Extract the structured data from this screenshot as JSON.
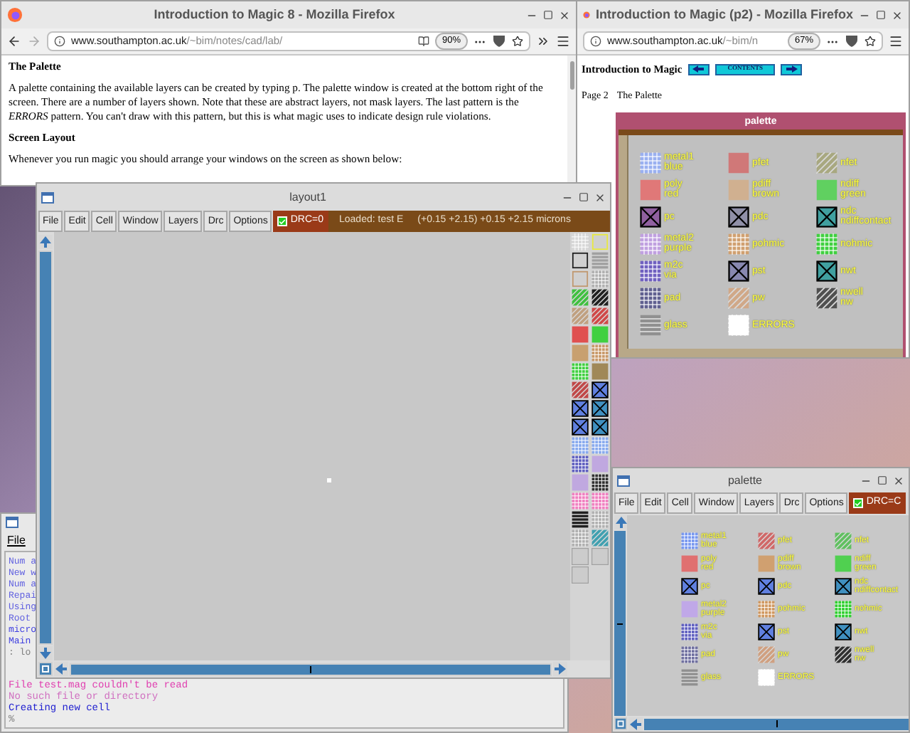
{
  "browser_main": {
    "title": "Introduction to Magic 8 - Mozilla Firefox",
    "url_host": "www.southampton.ac.uk",
    "url_path": "/~bim/notes/cad/lab/",
    "zoom": "90%",
    "heading_1": "The Palette",
    "paragraph_1": "A palette containing the available layers can be created by typing p. The palette window is created at the bottom right of the screen. There are a number of layers shown. Note that these are abstract layers, not mask layers. The last pattern is the *ERRORS* pattern. You can't draw with this pattern, but this is what magic uses to indicate design rule violations.",
    "heading_2": "Screen Layout",
    "paragraph_2": "Whenever you run magic you should arrange your windows on the screen as shown below:"
  },
  "browser_p2": {
    "title": "Introduction to Magic (p2) - Mozilla Firefox",
    "url_host": "www.southampton.ac.uk",
    "url_path": "/~bim/n",
    "zoom": "67%",
    "page_title": "Introduction to Magic",
    "contents": "CONTENTS",
    "page_number": "Page 2",
    "page_heading": "The Palette",
    "palette_image": {
      "title": "palette",
      "layers": [
        {
          "lines": [
            "metal1",
            "blue"
          ],
          "color": "#9ab0f0",
          "kind": "grid"
        },
        {
          "lines": [
            "pfet"
          ],
          "color": "#d07878",
          "kind": "solid"
        },
        {
          "lines": [
            "nfet"
          ],
          "color": "#a8a880",
          "kind": "hatch"
        },
        {
          "lines": [
            "poly",
            "red"
          ],
          "color": "#e07878",
          "kind": "solid"
        },
        {
          "lines": [
            "pdiff",
            "brown"
          ],
          "color": "#d0b090",
          "kind": "solid"
        },
        {
          "lines": [
            "ndiff",
            "green"
          ],
          "color": "#60d060",
          "kind": "solid"
        },
        {
          "lines": [
            "pc"
          ],
          "color": "#9060a0",
          "kind": "cross"
        },
        {
          "lines": [
            "pdc"
          ],
          "color": "#9090a8",
          "kind": "cross"
        },
        {
          "lines": [
            "ndc",
            "ndiffcontact"
          ],
          "color": "#40a0a0",
          "kind": "cross"
        },
        {
          "lines": [
            "metal2",
            "purple"
          ],
          "color": "#c0a0e0",
          "kind": "grid"
        },
        {
          "lines": [
            "pohmic"
          ],
          "color": "#d0a070",
          "kind": "grid"
        },
        {
          "lines": [
            "nohmic"
          ],
          "color": "#40d040",
          "kind": "grid"
        },
        {
          "lines": [
            "m2c",
            "via"
          ],
          "color": "#7060c0",
          "kind": "grid"
        },
        {
          "lines": [
            "pst"
          ],
          "color": "#8888b0",
          "kind": "cross"
        },
        {
          "lines": [
            "nwt"
          ],
          "color": "#40a0a0",
          "kind": "cross"
        },
        {
          "lines": [
            "pad"
          ],
          "color": "#606090",
          "kind": "grid"
        },
        {
          "lines": [
            "pw"
          ],
          "color": "#d0a888",
          "kind": "hatch"
        },
        {
          "lines": [
            "nwell",
            "nw"
          ],
          "color": "#505050",
          "kind": "hatch"
        },
        {
          "lines": [
            "glass"
          ],
          "color": "#909090",
          "kind": "stripes"
        },
        {
          "lines": [
            "ERRORS"
          ],
          "color": "#ffffff",
          "kind": "grid"
        }
      ]
    }
  },
  "terminal": {
    "menu": "File",
    "lines_beside": [
      {
        "text": "Num a",
        "color": "#6060e0"
      },
      {
        "text": "New w",
        "color": "#6060e0"
      },
      {
        "text": "Num a",
        "color": "#6060e0"
      },
      {
        "text": "Repai",
        "color": "#6060e0"
      },
      {
        "text": "Using",
        "color": "#6060e0"
      },
      {
        "text": "Root",
        "color": "#6060e0"
      },
      {
        "text": "micro",
        "color": "#4040e0"
      },
      {
        "text": "Main",
        "color": "#4040e0"
      },
      {
        "text": ": lo",
        "color": "#808080"
      }
    ],
    "lines": [
      {
        "text": "File test.mag couldn't be read",
        "color": "#e040b0"
      },
      {
        "text": "No such file or directory",
        "color": "#d070c0"
      },
      {
        "text": "Creating new cell",
        "color": "#2020d0"
      },
      {
        "text": "%",
        "color": "#808080"
      }
    ]
  },
  "layout_window": {
    "title": "layout1",
    "menu": [
      "File",
      "Edit",
      "Cell",
      "Window",
      "Layers",
      "Drc",
      "Options"
    ],
    "drc": {
      "label": "DRC=0",
      "checked": true
    },
    "loaded": "Loaded: test E",
    "coordinates": "(+0.15 +2.15) +0.15 +2.15 microns",
    "swatches": [
      {
        "color": "#d8d8d8",
        "kind": "grid"
      },
      {
        "color": "#e8e840",
        "kind": "outline"
      },
      {
        "color": "#202020",
        "kind": "outline"
      },
      {
        "color": "#a0a0a0",
        "kind": "stripes"
      },
      {
        "color": "#c09870",
        "kind": "outline"
      },
      {
        "color": "#b0b0b0",
        "kind": "grid"
      },
      {
        "color": "#40c040",
        "kind": "hatch"
      },
      {
        "color": "#202020",
        "kind": "hatch"
      },
      {
        "color": "#c0a080",
        "kind": "hatch"
      },
      {
        "color": "#d04848",
        "kind": "hatch"
      },
      {
        "color": "#e05050",
        "kind": "solid"
      },
      {
        "color": "#40d040",
        "kind": "solid"
      },
      {
        "color": "#c8a070",
        "kind": "solid"
      },
      {
        "color": "#c89868",
        "kind": "grid"
      },
      {
        "color": "#40d040",
        "kind": "grid"
      },
      {
        "color": "#a08858",
        "kind": "solid"
      },
      {
        "color": "#c04848",
        "kind": "hatch"
      },
      {
        "color": "#6080e0",
        "kind": "cross"
      },
      {
        "color": "#6080e0",
        "kind": "cross"
      },
      {
        "color": "#4090c0",
        "kind": "cross"
      },
      {
        "color": "#6080e0",
        "kind": "cross"
      },
      {
        "color": "#4090c0",
        "kind": "cross"
      },
      {
        "color": "#88aaee",
        "kind": "grid"
      },
      {
        "color": "#88aaee",
        "kind": "grid"
      },
      {
        "color": "#6060c0",
        "kind": "grid"
      },
      {
        "color": "#c0a8e0",
        "kind": "solid"
      },
      {
        "color": "#c0a8e0",
        "kind": "solid"
      },
      {
        "color": "#303030",
        "kind": "grid"
      },
      {
        "color": "#f080c0",
        "kind": "grid"
      },
      {
        "color": "#f080c0",
        "kind": "grid"
      },
      {
        "color": "#202020",
        "kind": "stripes"
      },
      {
        "color": "#b0b0b0",
        "kind": "grid"
      },
      {
        "color": "#b0b0b0",
        "kind": "grid"
      },
      {
        "color": "#40a0b0",
        "kind": "hatch"
      },
      {
        "color": "#cccccc",
        "kind": "empty"
      },
      {
        "color": "#cccccc",
        "kind": "empty"
      },
      {
        "color": "#cccccc",
        "kind": "empty"
      }
    ]
  },
  "palette_window": {
    "title": "palette",
    "menu": [
      "File",
      "Edit",
      "Cell",
      "Window",
      "Layers",
      "Drc",
      "Options"
    ],
    "drc": {
      "label": "DRC=C",
      "checked": true
    },
    "layers": [
      {
        "lines": [
          "metal1",
          "blue"
        ],
        "color": "#7898f0",
        "kind": "grid"
      },
      {
        "lines": [
          "pfet"
        ],
        "color": "#d06868",
        "kind": "hatch"
      },
      {
        "lines": [
          "nfet"
        ],
        "color": "#60c060",
        "kind": "hatch"
      },
      {
        "lines": [
          "poly",
          "red"
        ],
        "color": "#e07070",
        "kind": "solid"
      },
      {
        "lines": [
          "pdiff",
          "brown"
        ],
        "color": "#d0a070",
        "kind": "solid"
      },
      {
        "lines": [
          "ndiff",
          "green"
        ],
        "color": "#50d050",
        "kind": "solid"
      },
      {
        "lines": [
          "pc"
        ],
        "color": "#6080e0",
        "kind": "cross"
      },
      {
        "lines": [
          "pdc"
        ],
        "color": "#6080e0",
        "kind": "cross"
      },
      {
        "lines": [
          "ndc",
          "ndiffcontact"
        ],
        "color": "#4090c0",
        "kind": "cross"
      },
      {
        "lines": [
          "metal2",
          "purple"
        ],
        "color": "#c0a8e8",
        "kind": "solid"
      },
      {
        "lines": [
          "pohmic"
        ],
        "color": "#d09860",
        "kind": "grid"
      },
      {
        "lines": [
          "nohmic"
        ],
        "color": "#30d030",
        "kind": "grid"
      },
      {
        "lines": [
          "m2c",
          "via"
        ],
        "color": "#6060c0",
        "kind": "grid"
      },
      {
        "lines": [
          "pst"
        ],
        "color": "#6080e0",
        "kind": "cross"
      },
      {
        "lines": [
          "nwt"
        ],
        "color": "#4090c0",
        "kind": "cross"
      },
      {
        "lines": [
          "pad"
        ],
        "color": "#7070a0",
        "kind": "grid"
      },
      {
        "lines": [
          "pw"
        ],
        "color": "#d0a080",
        "kind": "hatch"
      },
      {
        "lines": [
          "nwell",
          "nw"
        ],
        "color": "#303030",
        "kind": "hatch"
      },
      {
        "lines": [
          "glass"
        ],
        "color": "#909090",
        "kind": "stripes"
      },
      {
        "lines": [
          "ERRORS"
        ],
        "color": "#ffffff",
        "kind": "grid"
      }
    ]
  }
}
